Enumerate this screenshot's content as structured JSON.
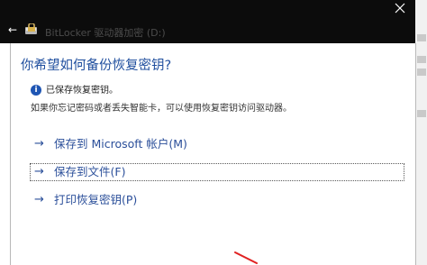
{
  "window": {
    "title": "BitLocker 驱动器加密 (D:)"
  },
  "dialog": {
    "heading": "你希望如何备份恢复密钥?",
    "info": {
      "icon": "info-icon",
      "text": "已保存恢复密钥。"
    },
    "description": "如果你忘记密码或者丢失智能卡，可以使用恢复密钥访问驱动器。",
    "options": [
      {
        "label": "保存到 Microsoft 帐户(M)",
        "icon": "arrow-right-icon"
      },
      {
        "label": "保存到文件(F)",
        "icon": "arrow-right-icon"
      },
      {
        "label": "打印恢复密钥(P)",
        "icon": "arrow-right-icon"
      }
    ]
  },
  "colors": {
    "titlebar": "#0c0c0c",
    "heading": "#1f4e9e",
    "link": "#2b4f9a",
    "info_icon": "#1e55b3",
    "annotation": "#e02020"
  }
}
